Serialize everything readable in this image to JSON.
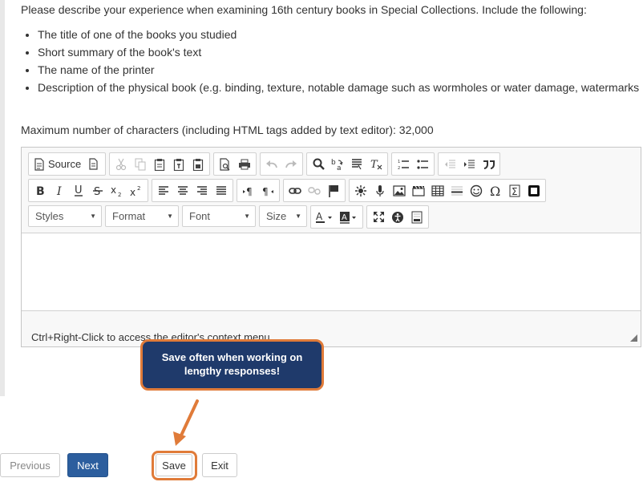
{
  "question": {
    "intro": "Please describe your experience when examining 16th century books in Special Collections. Include the following:",
    "requirements": [
      "The title of one of the books you studied",
      "Short summary of the book's text",
      "The name of the printer",
      "Description of the physical book (e.g. binding, texture, notable damage such as wormholes or water damage, watermarks"
    ],
    "max_chars": "Maximum number of characters (including HTML tags added by text editor): 32,000"
  },
  "editor": {
    "source_label": "Source",
    "combos": {
      "styles": "Styles",
      "format": "Format",
      "font": "Font",
      "size": "Size"
    },
    "status_text": "Ctrl+Right-Click to access the editor's context menu"
  },
  "callout": {
    "text": "Save often when working on lengthy responses!"
  },
  "buttons": {
    "previous": "Previous",
    "next": "Next",
    "save": "Save",
    "exit": "Exit"
  },
  "colors": {
    "accent_orange": "#e07b39",
    "callout_bg": "#1f3a6b",
    "next_button": "#2c5e9e"
  }
}
